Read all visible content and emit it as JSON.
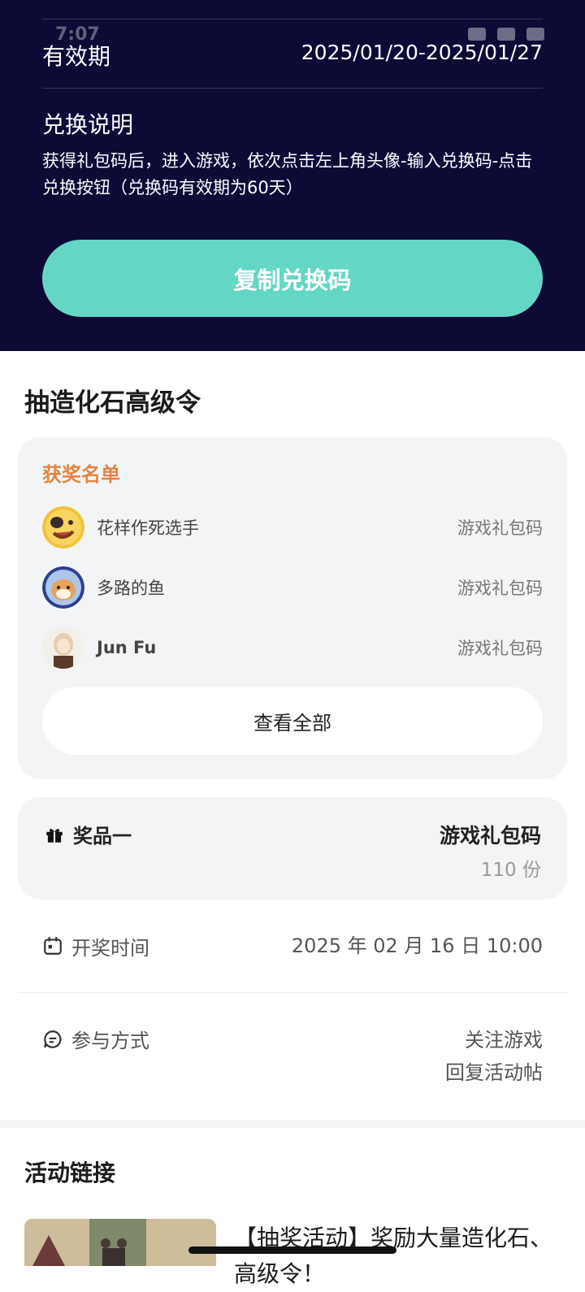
{
  "status_bar": {
    "time": "7:07"
  },
  "top_panel": {
    "validity_label": "有效期",
    "validity_value": "2025/01/20-2025/01/27",
    "explain_title": "兑换说明",
    "explain_text": "获得礼包码后，进入游戏，依次点击左上角头像-输入兑换码-点击兑换按钮（兑换码有效期为60天）",
    "copy_button": "复制兑换码"
  },
  "section_title": "抽造化石高级令",
  "winners": {
    "title": "获奖名单",
    "items": [
      {
        "name": "花样作死选手",
        "prize": "游戏礼包码"
      },
      {
        "name": "多路的鱼",
        "prize": "游戏礼包码"
      },
      {
        "name": "Jun Fu",
        "prize": "游戏礼包码"
      }
    ],
    "view_all": "查看全部"
  },
  "prize": {
    "label": "奖品一",
    "name": "游戏礼包码",
    "count": "110 份"
  },
  "draw_time": {
    "label": "开奖时间",
    "value": "2025 年 02 月 16 日 10:00"
  },
  "participation": {
    "label": "参与方式",
    "line1": "关注游戏",
    "line2": "回复活动帖"
  },
  "links": {
    "title": "活动链接",
    "item_title": "【抽奖活动】奖励大量造化石、高级令！"
  },
  "colors": {
    "top_bg": "#0d0a36",
    "accent": "#64d6c6",
    "winners_title": "#e58443"
  }
}
